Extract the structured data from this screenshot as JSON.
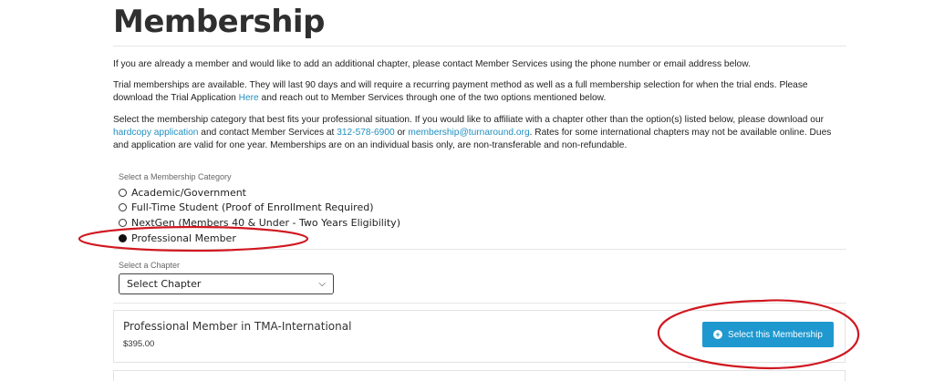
{
  "page": {
    "title": "Membership"
  },
  "paragraphs": {
    "p1": "If you are already a member and would like to add an additional chapter, please contact Member Services using the phone number or email address below.",
    "p2_before": "Trial memberships are available. They will last 90 days and will require a recurring payment method as well as a full membership selection for when the trial ends. Please download the Trial Application ",
    "p2_link": "Here",
    "p2_after": " and reach out to Member Services through one of the two options mentioned below.",
    "p3_a": "Select the membership category that best fits your professional situation. If you would like to affiliate with a chapter other than the option(s) listed below, please download our ",
    "p3_link1": "hardcopy application",
    "p3_b": " and contact Member Services at ",
    "p3_link2": "312-578-6900",
    "p3_c": " or ",
    "p3_link3": "membership@turnaround.org",
    "p3_d": ". Rates for some international chapters may not be available online. Dues and application are valid for one year. Memberships are on an individual basis only, are non-transferable and non-refundable."
  },
  "category": {
    "label": "Select a Membership Category",
    "options": [
      {
        "label": "Academic/Government",
        "selected": false
      },
      {
        "label": "Full-Time Student (Proof of Enrollment Required)",
        "selected": false
      },
      {
        "label": "NextGen (Members 40 & Under - Two Years Eligibility)",
        "selected": false
      },
      {
        "label": "Professional Member",
        "selected": true
      }
    ]
  },
  "chapter": {
    "label": "Select a Chapter",
    "selected": "Select Chapter"
  },
  "result_card": {
    "title": "Professional Member in TMA-International",
    "price": "$395.00",
    "button_label": "Select this Membership"
  },
  "colors": {
    "link": "#1f8fc0",
    "button": "#1e98cf",
    "annotation": "#d01820"
  },
  "icons": {
    "button_icon": "plus-circle-icon",
    "select_icon": "chevron-down-icon"
  }
}
